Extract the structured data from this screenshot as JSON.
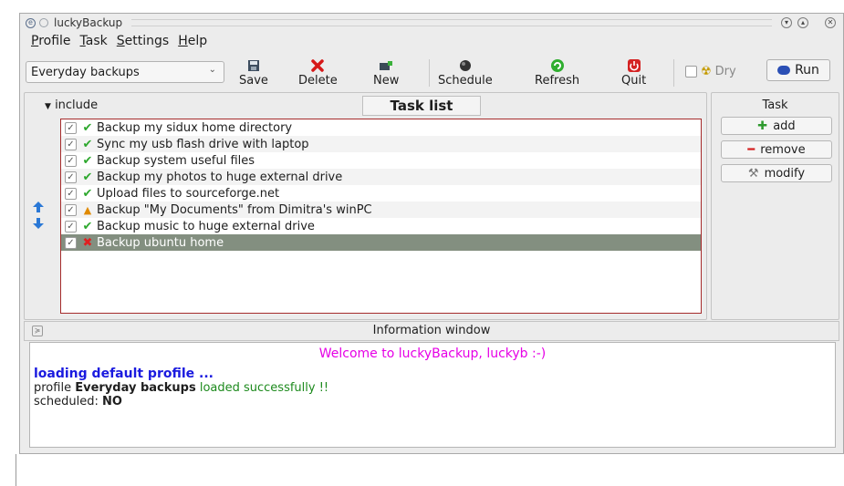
{
  "window": {
    "title": "luckyBackup"
  },
  "menu": [
    "Profile",
    "Task",
    "Settings",
    "Help"
  ],
  "toolbar": {
    "profile_value": "Everyday backups",
    "save": "Save",
    "delete": "Delete",
    "new": "New",
    "schedule": "Schedule",
    "refresh": "Refresh",
    "quit": "Quit",
    "dry": "Dry",
    "run": "Run"
  },
  "tasks": {
    "include_label": "include",
    "title": "Task list",
    "items": [
      {
        "label": "Backup my sidux home directory",
        "status": "ok"
      },
      {
        "label": "Sync my usb flash drive with laptop",
        "status": "ok"
      },
      {
        "label": "Backup system useful files",
        "status": "ok"
      },
      {
        "label": "Backup my photos to huge external drive",
        "status": "ok"
      },
      {
        "label": "Upload files to sourceforge.net",
        "status": "ok"
      },
      {
        "label": "Backup \"My Documents\" from Dimitra's winPC",
        "status": "warning"
      },
      {
        "label": "Backup music to huge external drive",
        "status": "ok"
      },
      {
        "label": "Backup ubuntu home",
        "status": "error"
      }
    ]
  },
  "task_panel": {
    "title": "Task",
    "add": "add",
    "remove": "remove",
    "modify": "modify"
  },
  "info": {
    "title": "Information window",
    "welcome": "Welcome to luckyBackup, luckyb :-)",
    "loading": "loading default profile ...",
    "profile_prefix": "profile",
    "profile_name": "Everyday backups",
    "loaded": "loaded successfully !!",
    "scheduled_label": "scheduled:",
    "scheduled_value": "NO"
  },
  "colors": {
    "welcome": "#e600e6",
    "loading": "#1a1adf",
    "ok": "#1d8a1d",
    "list_border": "#a52b2b",
    "selected_row": "#838f80"
  }
}
